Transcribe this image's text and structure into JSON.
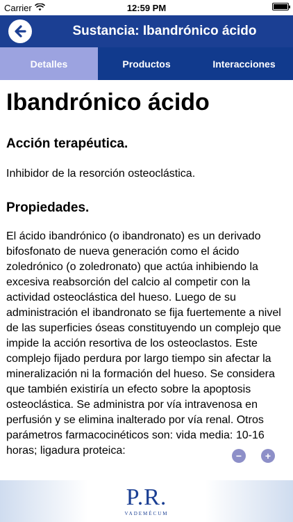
{
  "status_bar": {
    "carrier": "Carrier",
    "time": "12:59 PM",
    "battery_level": 1.0
  },
  "nav": {
    "title": "Sustancia: Ibandrónico ácido",
    "back_icon": "back-arrow-icon"
  },
  "tabs": [
    {
      "label": "Detalles",
      "active": true
    },
    {
      "label": "Productos",
      "active": false
    },
    {
      "label": "Interacciones",
      "active": false
    }
  ],
  "content": {
    "title": "Ibandrónico ácido",
    "sections": [
      {
        "heading": "Acción terapéutica.",
        "text": "Inhibidor de la resorción osteoclástica."
      },
      {
        "heading": "Propiedades.",
        "text": "El ácido ibandrónico (o ibandronato) es un derivado bifosfonato de nueva generación como el ácido zoledrónico (o zoledronato) que actúa inhibiendo la excesiva reabsorción del calcio al competir con la actividad osteoclástica del hueso. Luego de su administración el ibandronato se fija fuertemente a nivel de las superficies óseas constituyendo un complejo que impide la acción resortiva de los osteoclastos. Este complejo fijado perdura por largo tiempo sin afectar la mineralización ni la formación del hueso. Se considera que también existiría un efecto sobre la apoptosis osteoclástica. Se administra por vía intravenosa en perfusión y se elimina inalterado por vía renal. Otros parámetros farmacocinéticos son: vida media: 10-16 horas; ligadura proteica:"
      }
    ]
  },
  "zoom": {
    "out_symbol": "−",
    "in_symbol": "+"
  },
  "footer": {
    "logo": "P.R.",
    "subtitle": "VADEMÉCUM"
  },
  "colors": {
    "nav_bg": "#1b3f93",
    "tab_bg": "#113a8d",
    "tab_active": "#9ca3e0"
  }
}
